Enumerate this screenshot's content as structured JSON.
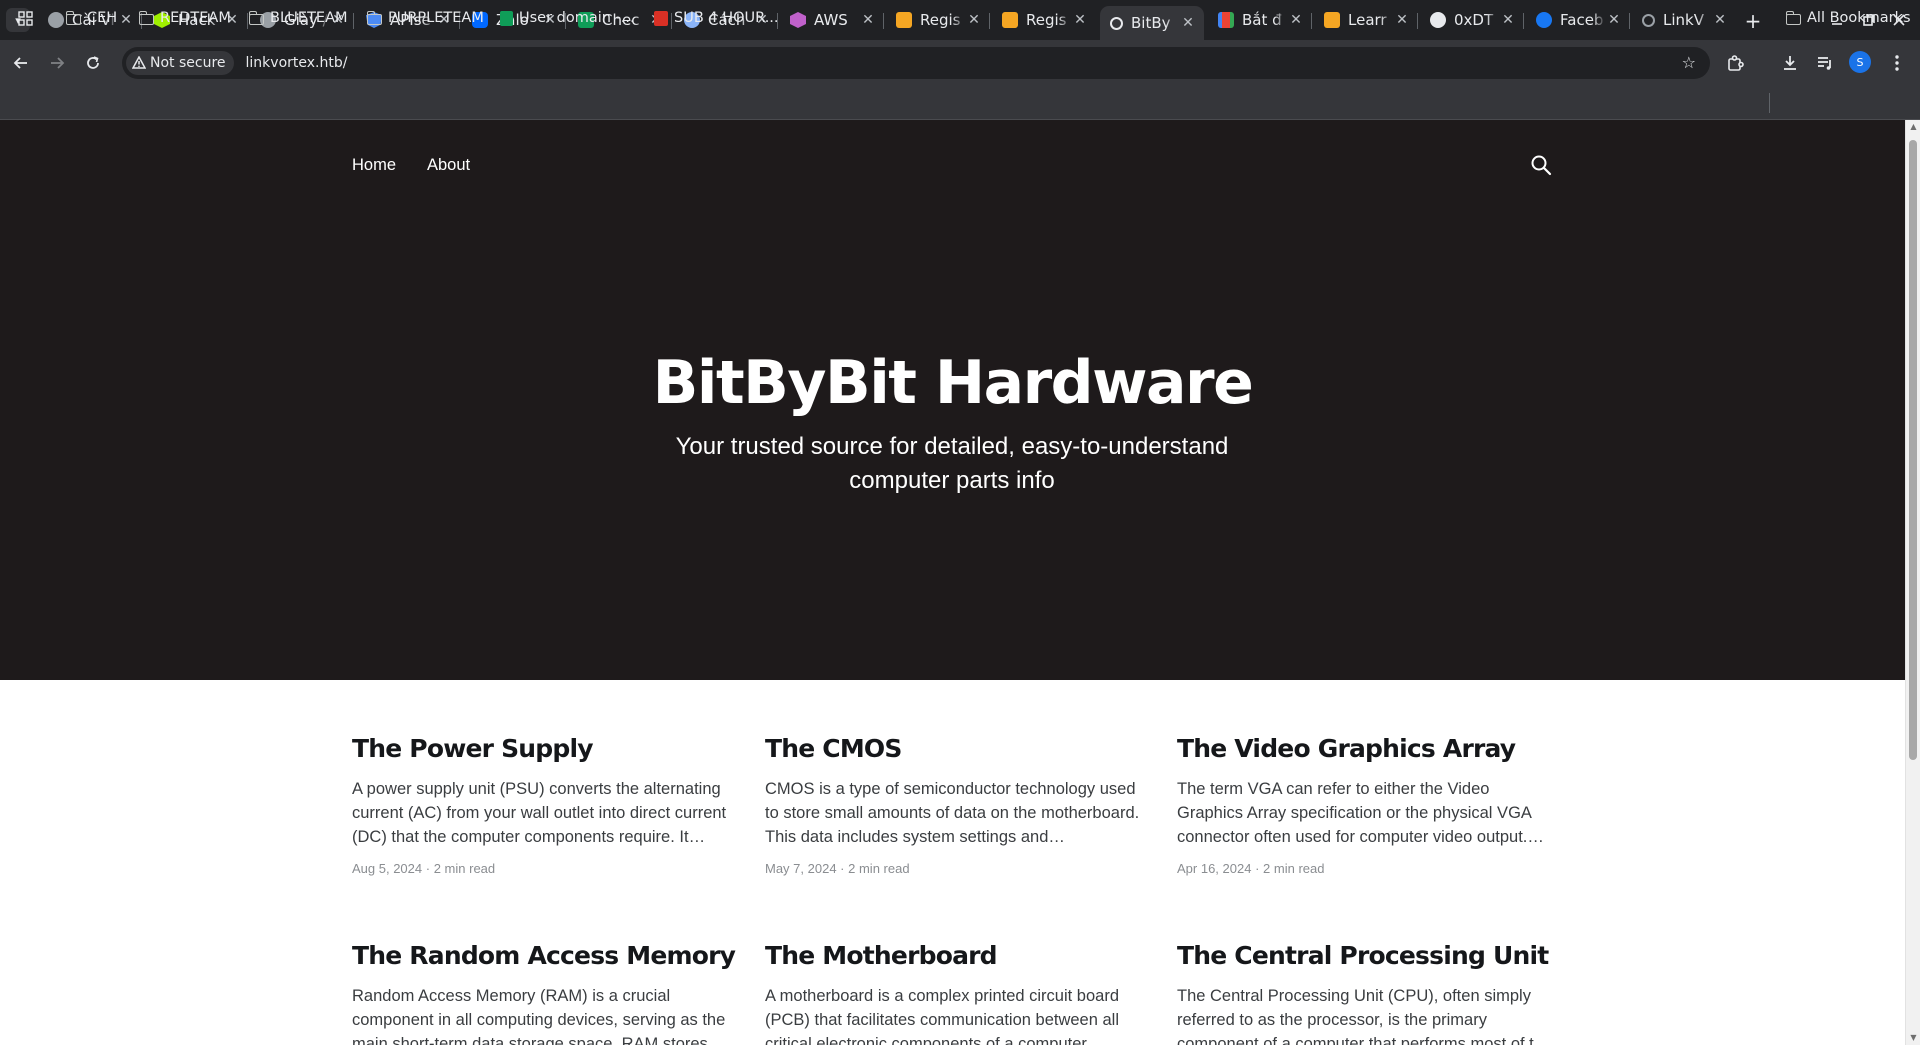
{
  "browser": {
    "tabs": [
      {
        "title": "Cài Vi",
        "favicon_color": "#9aa0a6"
      },
      {
        "title": "Hack",
        "favicon_color": "#9fef00"
      },
      {
        "title": "Giày /",
        "favicon_color": "#9aa0a6"
      },
      {
        "title": "APIse",
        "favicon_color": "#4c8bf5"
      },
      {
        "title": "Zalo",
        "favicon_color": "#0068ff"
      },
      {
        "title": "Chec",
        "favicon_color": "#0f9d58"
      },
      {
        "title": "Cách",
        "favicon_color": "#8ab4f8"
      },
      {
        "title": "AWS",
        "favicon_color": "#c061cb"
      },
      {
        "title": "Regis",
        "favicon_color": "#f5a623"
      },
      {
        "title": "Regis",
        "favicon_color": "#f5a623"
      },
      {
        "title": "BitBy",
        "favicon_color": "#e8eaed",
        "active": true
      },
      {
        "title": "Bắt đ",
        "favicon_color": "#ea4335"
      },
      {
        "title": "Learr",
        "favicon_color": "#f5a623"
      },
      {
        "title": "0xDT",
        "favicon_color": "#e8eaed"
      },
      {
        "title": "Faceb",
        "favicon_color": "#1877f2"
      },
      {
        "title": "LinkV",
        "favicon_color": "#9aa0a6"
      }
    ],
    "address_bar": {
      "security_label": "Not secure",
      "url": "linkvortex.htb/"
    },
    "profile_initial": "S",
    "bookmarks": [
      {
        "label": "CEH",
        "type": "folder"
      },
      {
        "label": "REDTEAM",
        "type": "folder"
      },
      {
        "label": "BLUETEAM",
        "type": "folder"
      },
      {
        "label": "PURPLETEAM",
        "type": "folder"
      },
      {
        "label": "User domain -...",
        "type": "sheet"
      },
      {
        "label": "SUB 4 HOUR...",
        "type": "link"
      }
    ],
    "all_bookmarks_label": "All Bookmarks"
  },
  "site": {
    "nav": {
      "home": "Home",
      "about": "About"
    },
    "hero": {
      "title": "BitByBit Hardware",
      "subtitle": "Your trusted source for detailed, easy-to-understand computer parts info"
    },
    "posts": [
      {
        "title": "The Power Supply",
        "excerpt": "A power supply unit (PSU) converts the alternating current (AC) from your wall outlet into direct current (DC) that the computer components require. It…",
        "date": "Aug 5, 2024",
        "read_time": "2 min read"
      },
      {
        "title": "The CMOS",
        "excerpt": "CMOS is a type of semiconductor technology used to store small amounts of data on the motherboard. This data includes system settings and configurati…",
        "date": "May 7, 2024",
        "read_time": "2 min read"
      },
      {
        "title": "The Video Graphics Array",
        "excerpt": "The term VGA can refer to either the Video Graphics Array specification or the physical VGA connector often used for computer video output. Below, I'll…",
        "date": "Apr 16, 2024",
        "read_time": "2 min read"
      },
      {
        "title": "The Random Access Memory",
        "excerpt": "Random Access Memory (RAM) is a crucial component in all computing devices, serving as the main short-term data storage space. RAM stores t…",
        "date": "",
        "read_time": ""
      },
      {
        "title": "The Motherboard",
        "excerpt": "A motherboard is a complex printed circuit board (PCB) that facilitates communication between all critical electronic components of a computer…",
        "date": "",
        "read_time": ""
      },
      {
        "title": "The Central Processing Unit",
        "excerpt": "The Central Processing Unit (CPU), often simply referred to as the processor, is the primary component of a computer that performs most of t…",
        "date": "",
        "read_time": ""
      }
    ],
    "meta_separator": "·"
  },
  "colors": {
    "hero_bg": "#1e1a1b",
    "browser_frame": "#202124",
    "browser_toolbar": "#35363a"
  }
}
